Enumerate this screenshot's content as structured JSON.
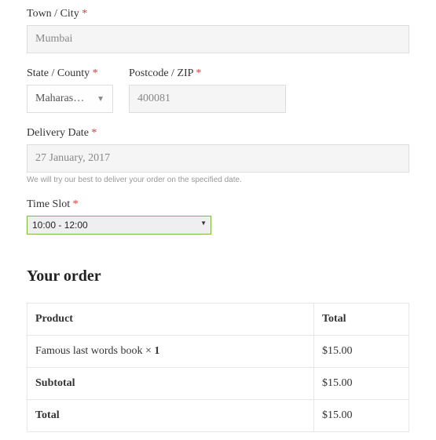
{
  "form": {
    "city": {
      "label": "Town / City",
      "value": "Mumbai"
    },
    "state": {
      "label": "State / County",
      "value": "Maharas…"
    },
    "zip": {
      "label": "Postcode / ZIP",
      "value": "400081"
    },
    "delivery": {
      "label": "Delivery Date",
      "value": "27 January, 2017",
      "help": "We will try our best to deliver your order on the specified date."
    },
    "timeslot": {
      "label": "Time Slot",
      "value": "10:00 - 12:00"
    }
  },
  "required_marker": "*",
  "order": {
    "heading": "Your order",
    "columns": {
      "product": "Product",
      "total": "Total"
    },
    "item": {
      "name": "Famous last words book",
      "qty_prefix": "  × ",
      "qty": "1",
      "price": "$15.00"
    },
    "subtotal": {
      "label": "Subtotal",
      "value": "$15.00"
    },
    "total": {
      "label": "Total",
      "value": "$15.00"
    }
  }
}
